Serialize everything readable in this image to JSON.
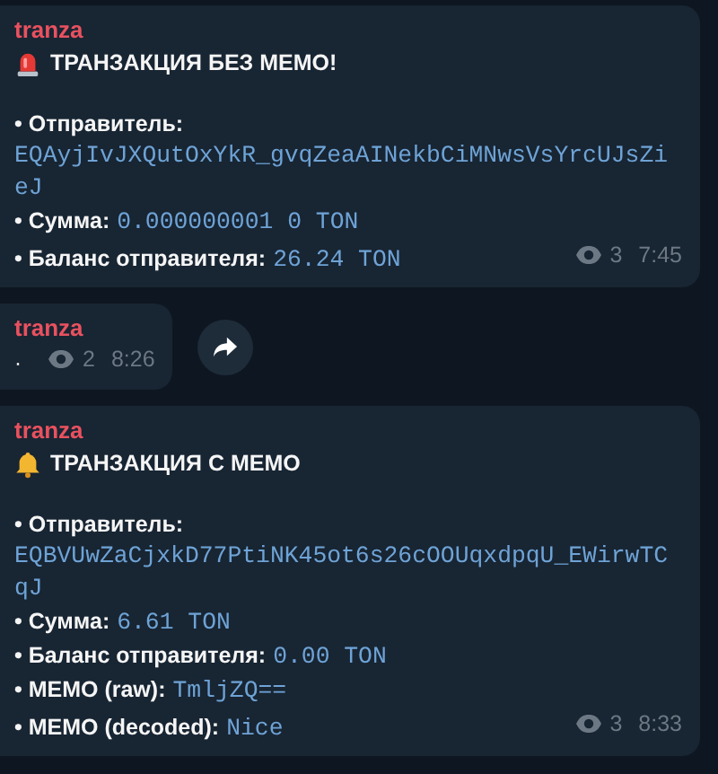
{
  "messages": [
    {
      "author": "tranza",
      "kind": "alert",
      "title": "ТРАНЗАКЦИЯ БЕЗ МЕМО!",
      "fields": [
        {
          "label": "• Отправитель:",
          "value": "EQAyjIvJXQutOxYkR_gvqZeaAINekbCiMNwsVsYrcUJsZieJ",
          "kind": "block"
        },
        {
          "label": "• Сумма:",
          "value": "0.000000001 0 TON",
          "kind": "inline"
        },
        {
          "label": "• Баланс отправителя:",
          "value": "26.24 TON",
          "kind": "inline"
        }
      ],
      "views": "3",
      "time": "7:45"
    },
    {
      "author": "tranza",
      "text": "·",
      "views": "2",
      "time": "8:26",
      "share": true
    },
    {
      "author": "tranza",
      "kind": "notice",
      "title": "ТРАНЗАКЦИЯ С МЕМО",
      "fields": [
        {
          "label": "• Отправитель:",
          "value": "EQBVUwZaCjxkD77PtiNK45ot6s26cOOUqxdpqU_EWirwTCqJ",
          "kind": "block"
        },
        {
          "label": "• Сумма:",
          "value": "6.61 TON",
          "kind": "inline"
        },
        {
          "label": "• Баланс отправителя:",
          "value": "0.00 TON",
          "kind": "inline"
        },
        {
          "label": "• MEMO (raw):",
          "value": "TmljZQ==",
          "kind": "inline"
        },
        {
          "label": "• MEMO (decoded):",
          "value": "Nice",
          "kind": "inline"
        }
      ],
      "views": "3",
      "time": "8:33"
    }
  ]
}
